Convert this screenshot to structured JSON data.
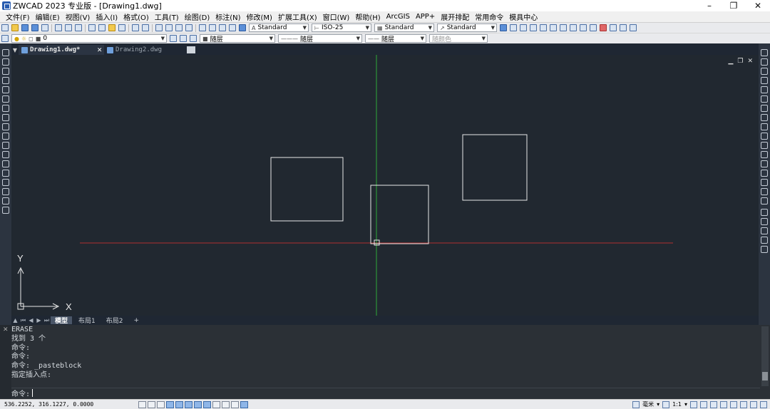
{
  "window": {
    "title": "ZWCAD 2023 专业版 - [Drawing1.dwg]",
    "minimize": "–",
    "maximize": "❐",
    "close": "✕"
  },
  "menu": [
    "文件(F)",
    "编辑(E)",
    "视图(V)",
    "插入(I)",
    "格式(O)",
    "工具(T)",
    "绘图(D)",
    "标注(N)",
    "修改(M)",
    "扩展工具(X)",
    "窗口(W)",
    "帮助(H)",
    "ArcGIS",
    "APP+",
    "展开排配",
    "常用命令",
    "模具中心"
  ],
  "toolbar": {
    "text_style": "Standard",
    "dim_style": "ISO-25",
    "table_style": "Standard",
    "mleader_style": "Standard",
    "layer": "0",
    "color": "随层",
    "linetype": "随层",
    "lineweight": "随层",
    "plotstyle": "随颜色"
  },
  "tabs": [
    {
      "label": "Drawing1.dwg*",
      "active": true
    },
    {
      "label": "Drawing2.dwg",
      "active": false
    }
  ],
  "tab_close": "✕",
  "viewport_controls": [
    "▁",
    "❐",
    "✕"
  ],
  "ucs": {
    "x_label": "X",
    "y_label": "Y"
  },
  "layout_tabs": [
    "模型",
    "布局1",
    "布局2",
    "+"
  ],
  "layout_active": "模型",
  "command": {
    "history": [
      "ERASE",
      "找到 3 个",
      "命令:",
      "命令:",
      "命令: _pasteblock",
      "指定插入点:"
    ],
    "prompt": "命令:"
  },
  "status": {
    "coordinates": "536.2252, 316.1227, 0.0000",
    "units": "毫米",
    "scale": "1:1"
  },
  "colors": {
    "canvas_bg": "#212830",
    "x_axis": "#b03030",
    "y_axis": "#2faa3a",
    "geometry": "#e8e8e8"
  }
}
